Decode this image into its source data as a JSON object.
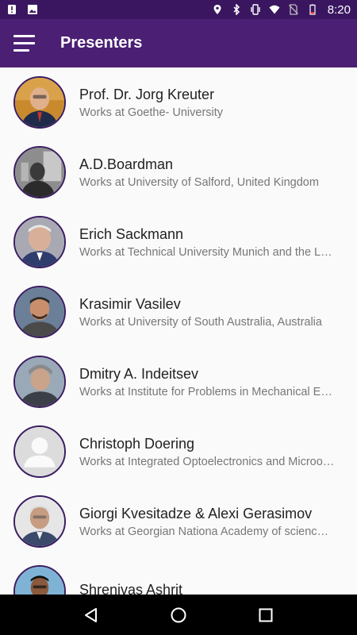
{
  "status_bar": {
    "time": "8:20",
    "icons": [
      "alert-icon",
      "image-icon",
      "location-icon",
      "bluetooth-icon",
      "vibrate-icon",
      "wifi-icon",
      "no-sim-icon",
      "battery-icon"
    ]
  },
  "app_bar": {
    "title": "Presenters",
    "menu_icon": "hamburger-menu-icon"
  },
  "presenters": [
    {
      "name": "Prof. Dr. Jorg Kreuter",
      "affiliation": "Works at Goethe- University"
    },
    {
      "name": "A.D.Boardman",
      "affiliation": "Works at University of Salford, United Kingdom"
    },
    {
      "name": "Erich Sackmann",
      "affiliation": "Works at Technical University Munich and the L…"
    },
    {
      "name": "Krasimir Vasilev",
      "affiliation": "Works at University of South Australia, Australia"
    },
    {
      "name": "Dmitry A. Indeitsev",
      "affiliation": "Works at Institute for Problems in Mechanical E…"
    },
    {
      "name": "Christoph Doering",
      "affiliation": "Works at Integrated Optoelectronics and Microo…"
    },
    {
      "name": "Giorgi Kvesitadze & Alexi Gerasimov",
      "affiliation": "Works at Georgian Nationa Academy of scienc…"
    },
    {
      "name": "Shrenivas Ashrit",
      "affiliation": ""
    }
  ],
  "nav_bar": {
    "back_icon": "back-triangle-icon",
    "home_icon": "home-circle-icon",
    "recents_icon": "recents-square-icon"
  },
  "colors": {
    "status_bar": "#3a1660",
    "app_bar": "#4b1f74",
    "avatar_ring": "#3b1d63"
  }
}
